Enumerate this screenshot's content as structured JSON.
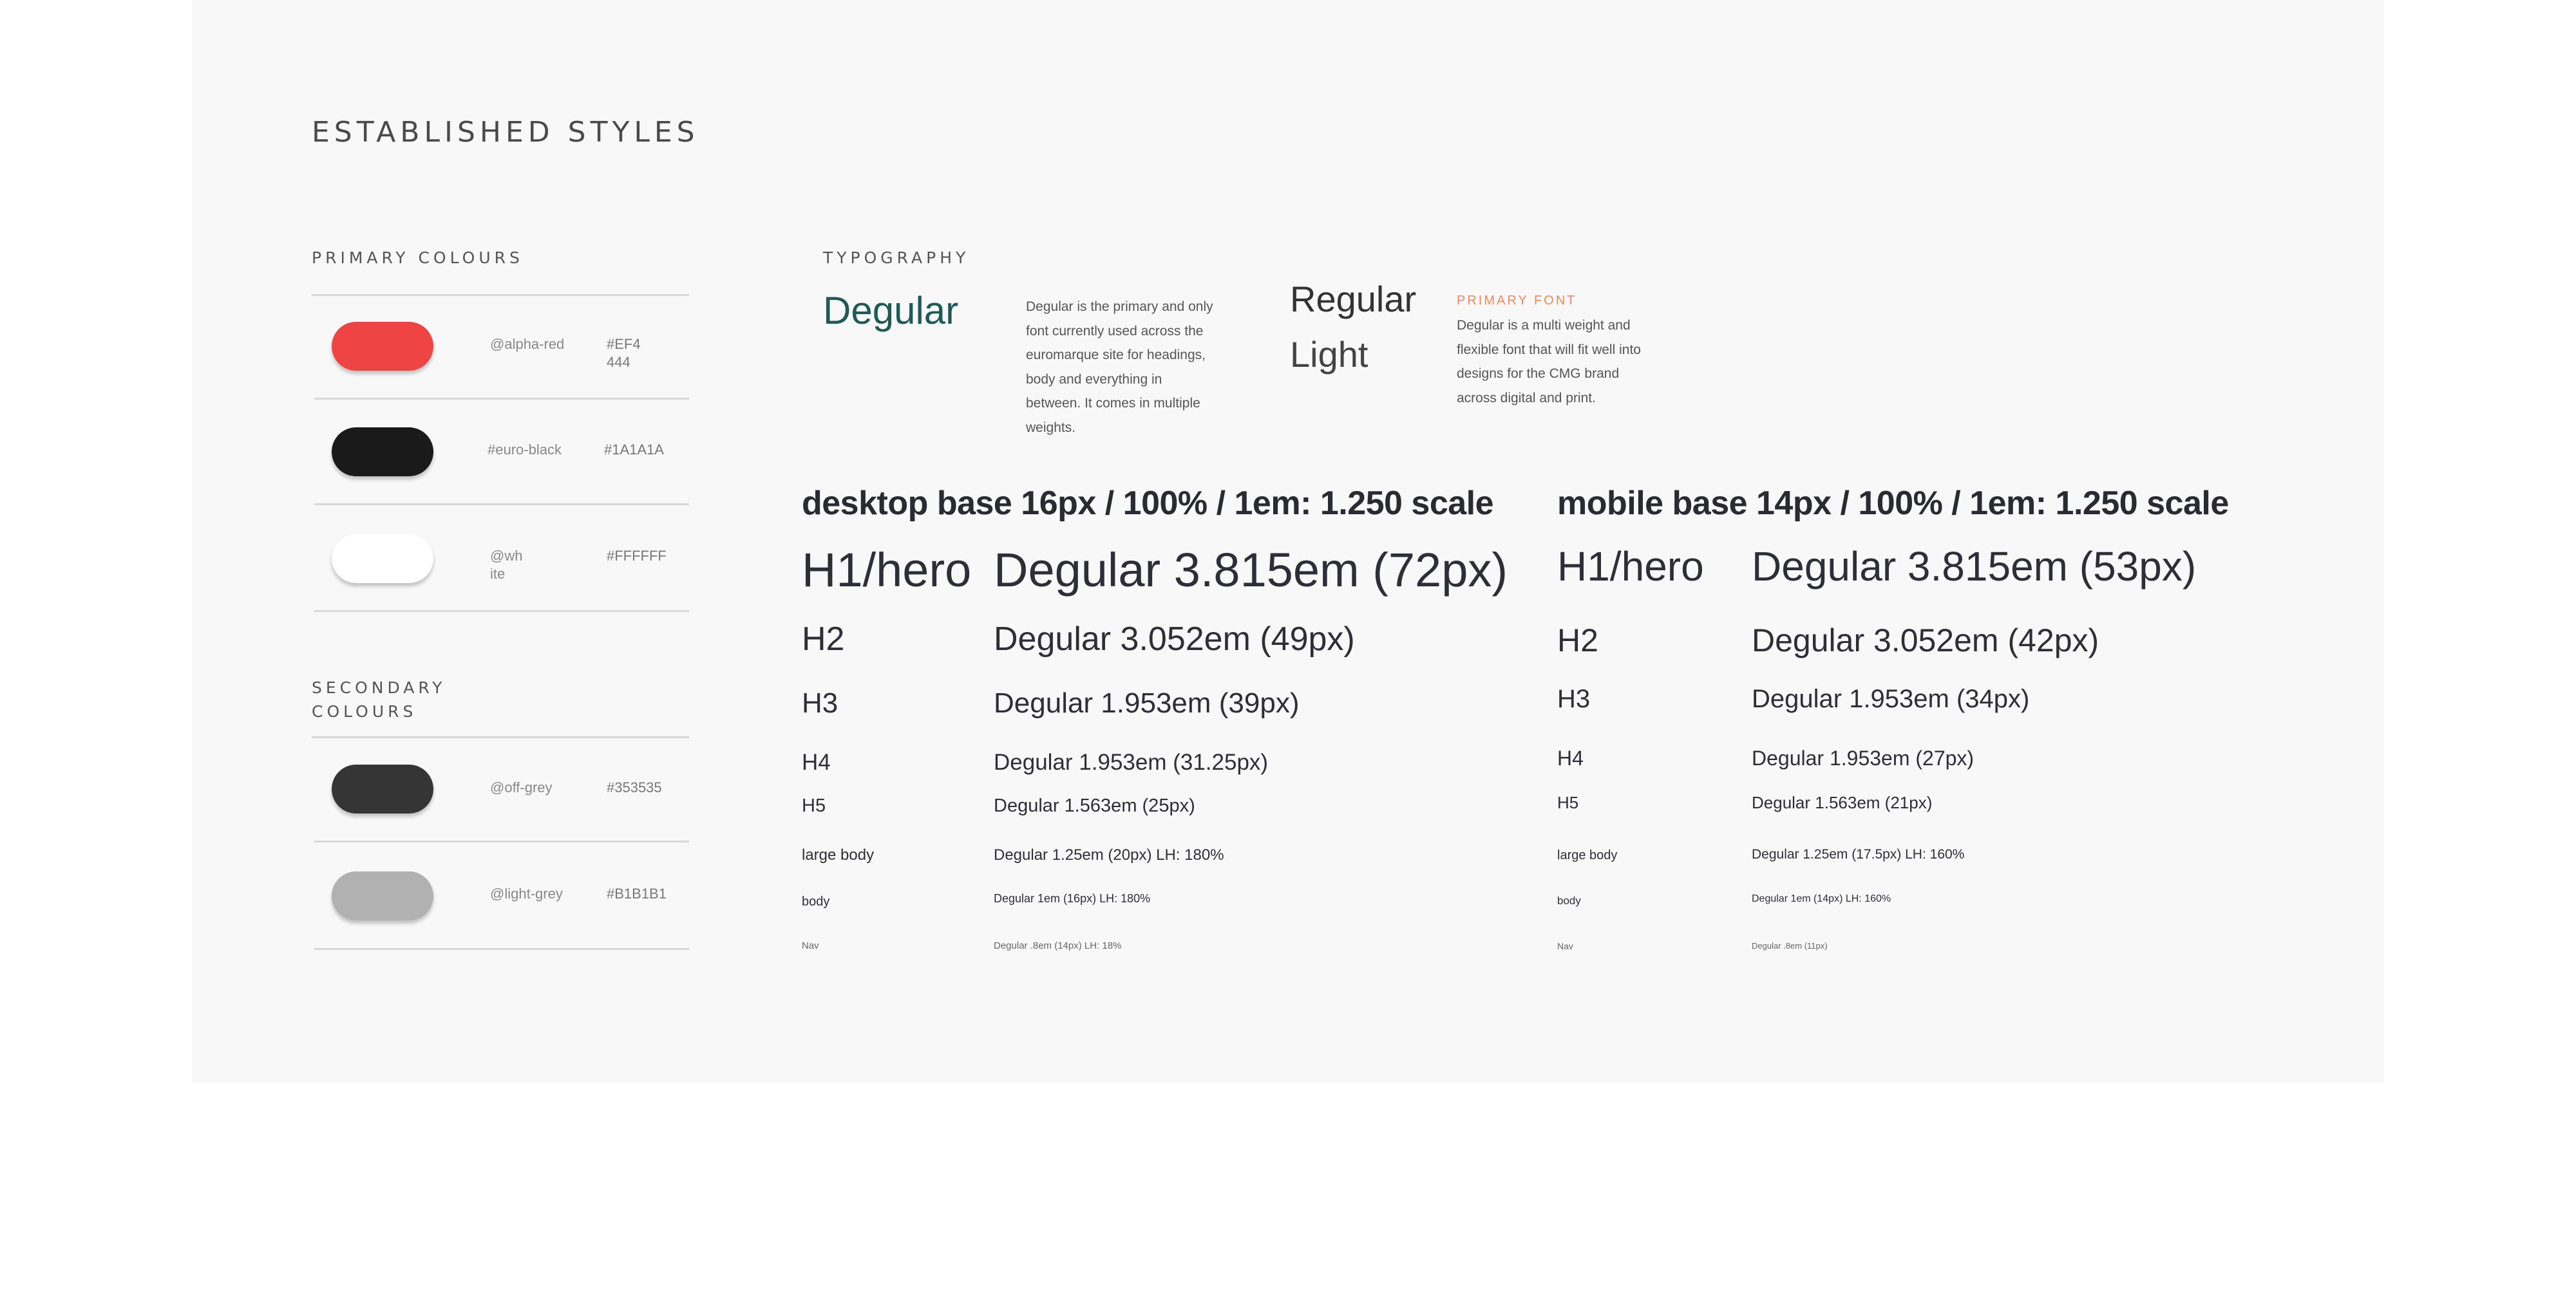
{
  "page": {
    "title": "ESTABLISHED STYLES"
  },
  "primary_colours": {
    "label": "PRIMARY COLOURS",
    "items": [
      {
        "token_line1": "@alpha-red",
        "token_line2": "",
        "hex_line1": "#EF4",
        "hex_line2": "444",
        "color": "#EF4444"
      },
      {
        "token_line1": "#euro-black",
        "token_line2": "",
        "hex_line1": "#1A1A1A",
        "hex_line2": "",
        "color": "#1A1A1A"
      },
      {
        "token_line1": "@wh",
        "token_line2": "ite",
        "hex_line1": "#FFFFFF",
        "hex_line2": "",
        "color": "#FFFFFF"
      }
    ]
  },
  "secondary_colours": {
    "label_line1": "SECONDARY",
    "label_line2": "COLOURS",
    "items": [
      {
        "token": "@off-grey",
        "hex": "#353535",
        "color": "#353535"
      },
      {
        "token": "@light-grey",
        "hex": "#B1B1B1",
        "color": "#B1B1B1"
      }
    ]
  },
  "typography": {
    "label": "TYPOGRAPHY",
    "font_name": "Degular",
    "font_name_color": "#1F5A55",
    "description_lines": [
      "Degular is the primary and only",
      "font currently used across the",
      "euromarque site for headings,",
      "body and everything in",
      "between. It comes in multiple",
      "weights."
    ],
    "weights": [
      "Regular",
      "Light"
    ],
    "primary_font_label": "PRIMARY FONT",
    "primary_font_label_color": "#F4875F",
    "primary_font_lines": [
      "Degular is a multi weight and",
      "flexible font that will fit well into",
      "designs for the CMG brand",
      "across digital and print."
    ]
  },
  "desktop_scale": {
    "title": "desktop base 16px / 100% / 1em: 1.250 scale",
    "rows": [
      {
        "label": "H1/hero",
        "value": "Degular 3.815em (72px)"
      },
      {
        "label": "H2",
        "value": "Degular 3.052em (49px)"
      },
      {
        "label": "H3",
        "value": "Degular 1.953em (39px)"
      },
      {
        "label": "H4",
        "value": "Degular 1.953em (31.25px)"
      },
      {
        "label": "H5",
        "value": "Degular 1.563em (25px)"
      },
      {
        "label": "large body",
        "value": "Degular 1.25em (20px) LH: 180%"
      },
      {
        "label": "body",
        "value": "Degular 1em (16px) LH: 180%"
      },
      {
        "label": "Nav",
        "value": "Degular .8em (14px) LH: 18%"
      }
    ]
  },
  "mobile_scale": {
    "title": "mobile base 14px / 100% / 1em: 1.250 scale",
    "rows": [
      {
        "label": "H1/hero",
        "value": "Degular 3.815em (53px)"
      },
      {
        "label": "H2",
        "value": "Degular 3.052em (42px)"
      },
      {
        "label": "H3",
        "value": "Degular 1.953em (34px)"
      },
      {
        "label": "H4",
        "value": "Degular 1.953em (27px)"
      },
      {
        "label": "H5",
        "value": "Degular 1.563em (21px)"
      },
      {
        "label": "large body",
        "value": "Degular 1.25em (17.5px) LH: 160%"
      },
      {
        "label": "body",
        "value": "Degular 1em (14px) LH: 160%"
      },
      {
        "label": "Nav",
        "value": "Degular .8em (11px)"
      }
    ]
  }
}
